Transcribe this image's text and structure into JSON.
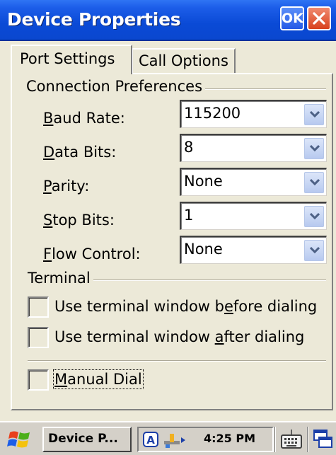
{
  "window": {
    "title": "Device Properties",
    "ok_label": "OK"
  },
  "tabs": [
    {
      "label": "Port Settings",
      "active": true
    },
    {
      "label": "Call Options",
      "active": false
    }
  ],
  "connection": {
    "group_label": "Connection Preferences",
    "fields": [
      {
        "pre": "",
        "ul": "B",
        "post": "aud Rate:",
        "value": "115200"
      },
      {
        "pre": "",
        "ul": "D",
        "post": "ata Bits:",
        "value": "8"
      },
      {
        "pre": "",
        "ul": "P",
        "post": "arity:",
        "value": "None"
      },
      {
        "pre": "",
        "ul": "S",
        "post": "top Bits:",
        "value": "1"
      },
      {
        "pre": "",
        "ul": "F",
        "post": "low Control:",
        "value": "None"
      }
    ]
  },
  "terminal": {
    "group_label": "Terminal",
    "before": {
      "pre": "Use terminal window b",
      "ul": "e",
      "post": "fore dialing",
      "checked": false
    },
    "after": {
      "pre": "Use terminal window ",
      "ul": "a",
      "post": "fter dialing",
      "checked": false
    }
  },
  "manual_dial": {
    "pre": "",
    "ul": "M",
    "post": "anual Dial",
    "checked": false
  },
  "taskbar": {
    "task_label": "Device P...",
    "time": "4:25 PM"
  }
}
